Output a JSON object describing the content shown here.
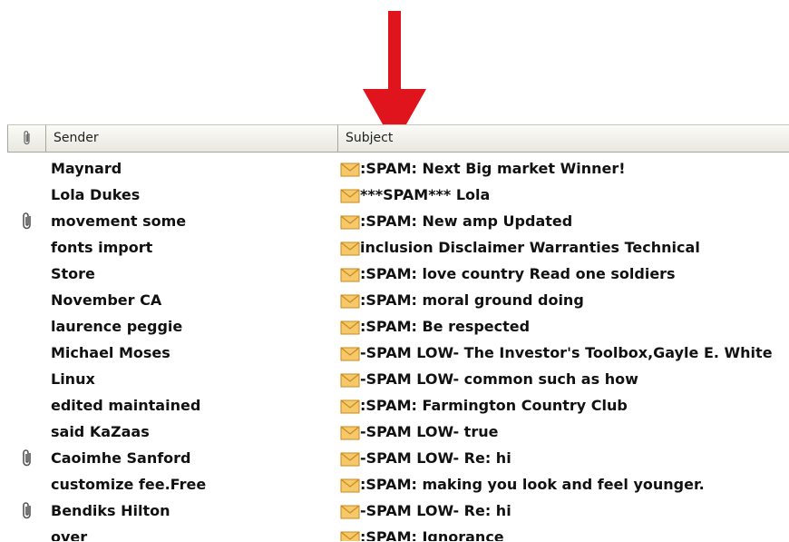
{
  "colors": {
    "arrow": "#e0141c",
    "envelope_fill": "#f5c96b",
    "envelope_stroke": "#c98a1c"
  },
  "header": {
    "attach_icon": "paperclip-icon",
    "sender": "Sender",
    "subject": "Subject"
  },
  "rows": [
    {
      "attachment": false,
      "sender": "Maynard",
      "subject": ":SPAM: Next Big market Winner!"
    },
    {
      "attachment": false,
      "sender": "Lola Dukes",
      "subject": "***SPAM*** Lola"
    },
    {
      "attachment": true,
      "sender": "movement some",
      "subject": ":SPAM: New amp Updated"
    },
    {
      "attachment": false,
      "sender": "fonts import",
      "subject": "inclusion Disclaimer Warranties Technical"
    },
    {
      "attachment": false,
      "sender": "Store",
      "subject": ":SPAM: love country Read one soldiers"
    },
    {
      "attachment": false,
      "sender": "November CA",
      "subject": ":SPAM: moral ground doing"
    },
    {
      "attachment": false,
      "sender": "laurence peggie",
      "subject": ":SPAM: Be respected"
    },
    {
      "attachment": false,
      "sender": "Michael Moses",
      "subject": "-SPAM LOW- The Investor's Toolbox,Gayle E. White"
    },
    {
      "attachment": false,
      "sender": "Linux",
      "subject": "-SPAM LOW- common such as how"
    },
    {
      "attachment": false,
      "sender": "edited maintained",
      "subject": ":SPAM: Farmington Country Club"
    },
    {
      "attachment": false,
      "sender": "said KaZaas",
      "subject": "-SPAM LOW- true"
    },
    {
      "attachment": true,
      "sender": "Caoimhe Sanford",
      "subject": "-SPAM LOW- Re: hi"
    },
    {
      "attachment": false,
      "sender": "customize fee.Free",
      "subject": ":SPAM: making you look and feel younger."
    },
    {
      "attachment": true,
      "sender": "Bendiks Hilton",
      "subject": "-SPAM LOW- Re: hi"
    },
    {
      "attachment": false,
      "sender": "over",
      "subject": ":SPAM: Ignorance"
    }
  ]
}
